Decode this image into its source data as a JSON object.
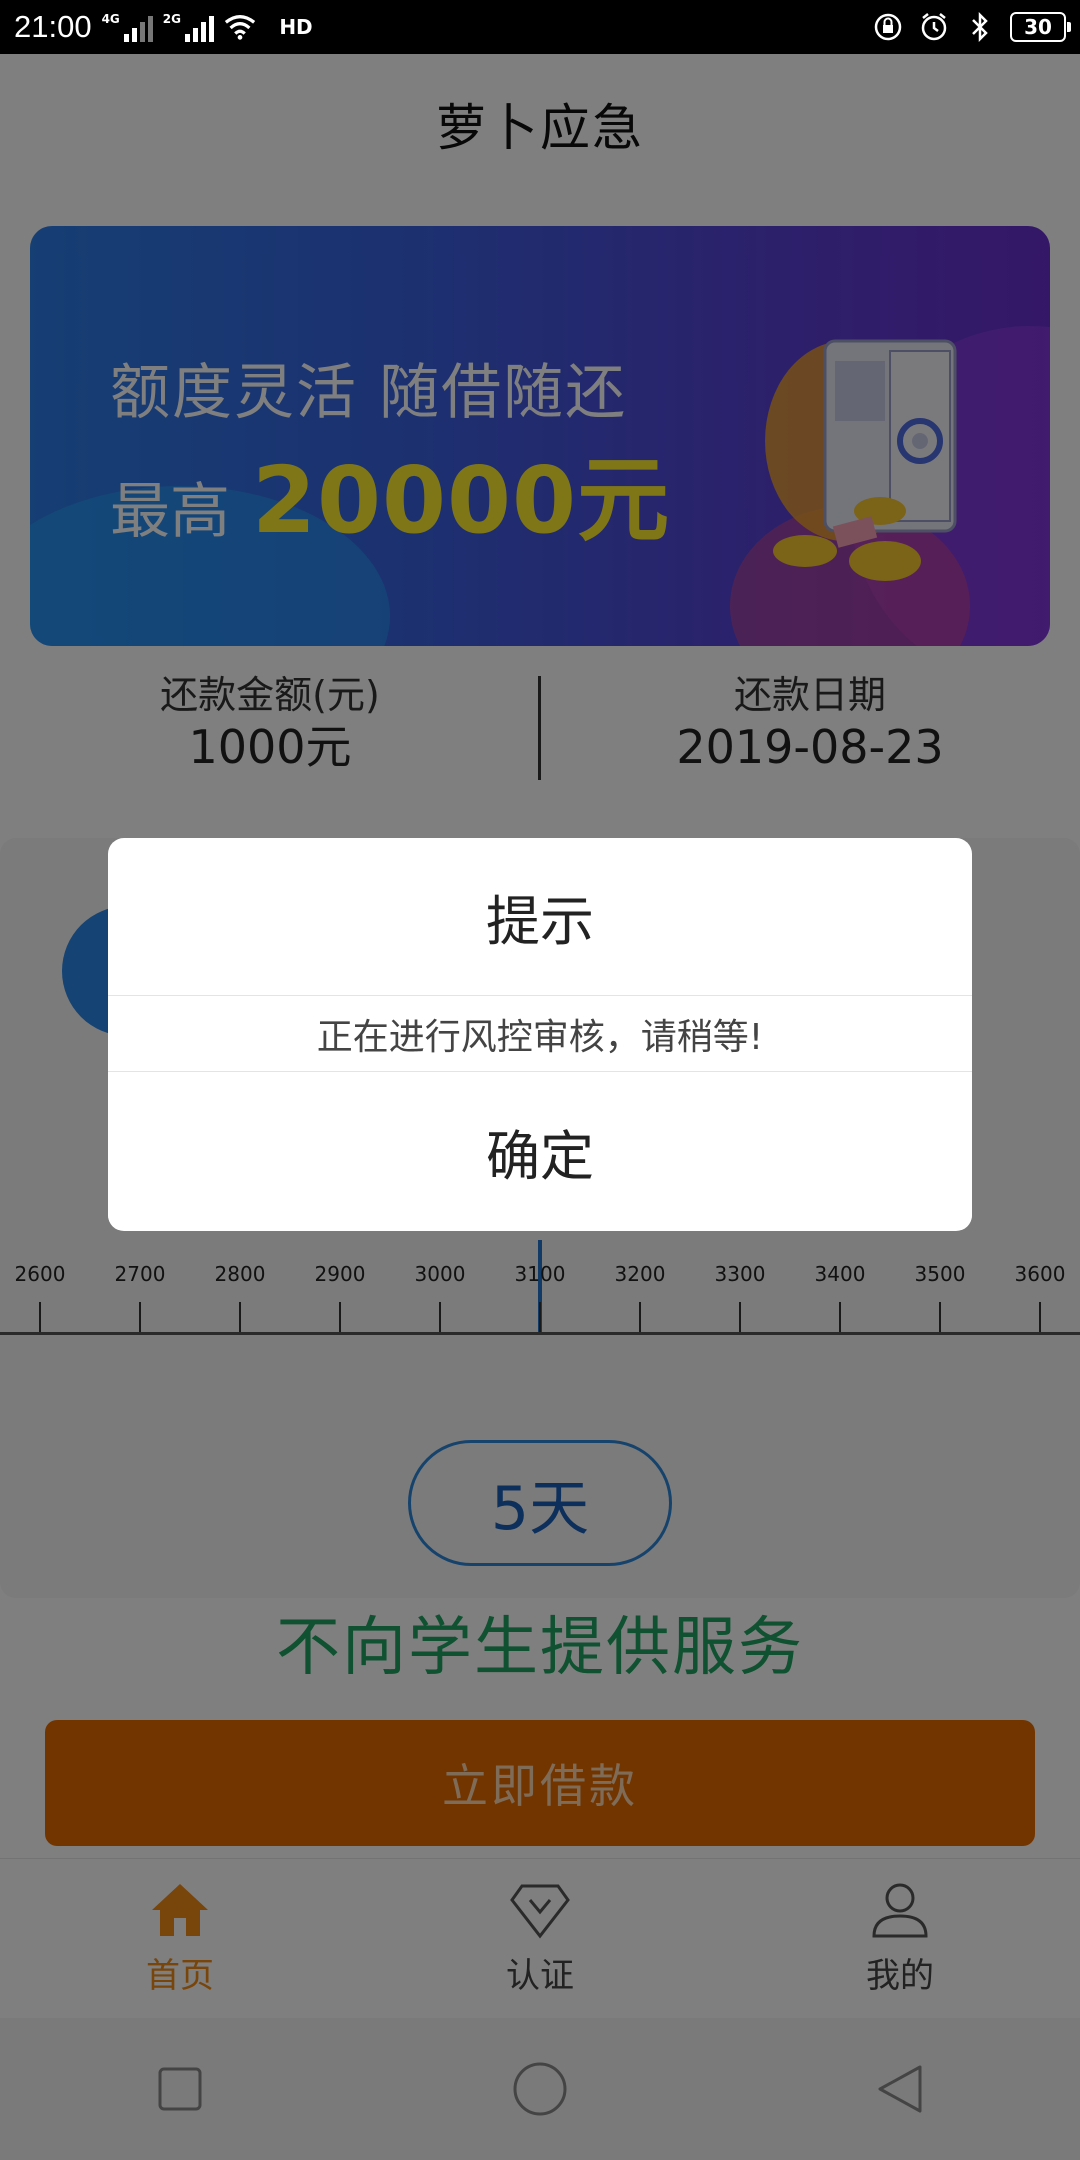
{
  "status_bar": {
    "time": "21:00",
    "sim1_label": "4G",
    "sim2_label": "2G",
    "hd_label": "HD",
    "battery": "30"
  },
  "header": {
    "title": "萝卜应急"
  },
  "banner": {
    "line1": "额度灵活 随借随还",
    "prefix": "最高",
    "amount": "20000元",
    "amount_color": "#ffec2e"
  },
  "repay": {
    "amount_label": "还款金额(元)",
    "amount_value": "1000元",
    "date_label": "还款日期",
    "date_value": "2019-08-23"
  },
  "ruler": {
    "labels": [
      "2600",
      "2700",
      "2800",
      "2900",
      "3000",
      "3100",
      "3200",
      "3300",
      "3400",
      "3500",
      "3600"
    ],
    "selected": "3100"
  },
  "days": {
    "value": "5天"
  },
  "notice": {
    "text": "不向学生提供服务",
    "color": "#1ea360"
  },
  "borrow_button": {
    "label": "立即借款",
    "color": "#e66a00"
  },
  "tabs": [
    {
      "label": "首页",
      "icon": "home-icon",
      "active": true
    },
    {
      "label": "认证",
      "icon": "diamond-icon",
      "active": false
    },
    {
      "label": "我的",
      "icon": "profile-icon",
      "active": false
    }
  ],
  "accent_color": "#f08a17",
  "modal": {
    "title": "提示",
    "message": "正在进行风控审核，请稍等!",
    "confirm_label": "确定"
  }
}
